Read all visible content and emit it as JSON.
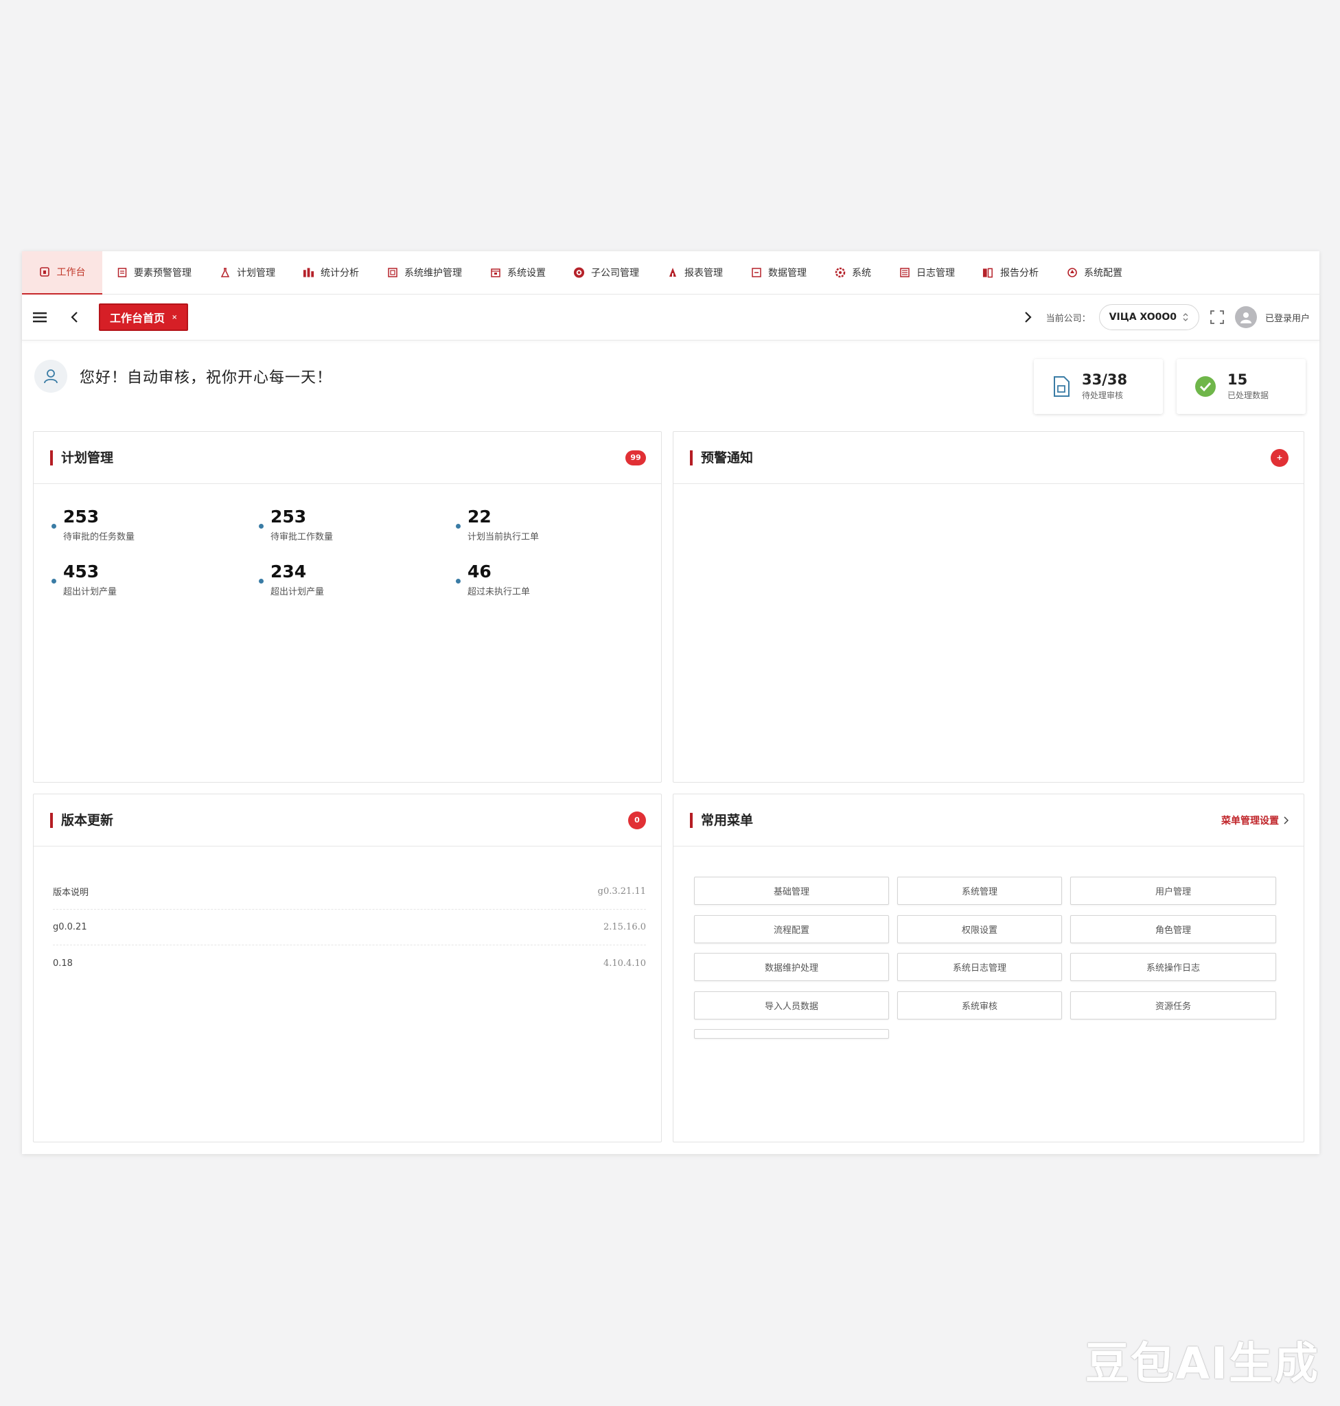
{
  "module_tabs": [
    {
      "label": "工作台",
      "icon": "home-icon"
    },
    {
      "label": "要素预警管理",
      "icon": "document-icon"
    },
    {
      "label": "计划管理",
      "icon": "flask-icon"
    },
    {
      "label": "统计分析",
      "icon": "chart-icon"
    },
    {
      "label": "系统维护管理",
      "icon": "form-icon"
    },
    {
      "label": "系统设置",
      "icon": "calendar-icon"
    },
    {
      "label": "子公司管理",
      "icon": "target-icon"
    },
    {
      "label": "报表管理",
      "icon": "tree-icon"
    },
    {
      "label": "数据管理",
      "icon": "folder-icon"
    },
    {
      "label": "系统",
      "icon": "gear-icon"
    },
    {
      "label": "日志管理",
      "icon": "list-icon"
    },
    {
      "label": "报告分析",
      "icon": "report-icon"
    },
    {
      "label": "系统配置",
      "icon": "settings-icon"
    }
  ],
  "toolbar": {
    "page_tag": "工作台首页",
    "company_label": "当前公司：",
    "company_value": "VIЦA XO0O0",
    "username": "已登录用户"
  },
  "greeting": {
    "text": "您好！自动审核，祝你开心每一天！"
  },
  "stats": [
    {
      "value": "33/38",
      "label": "待处理审核",
      "icon": "document-icon"
    },
    {
      "value": "15",
      "label": "已处理数据",
      "icon": "check-circle-icon"
    }
  ],
  "plan_panel": {
    "title": "计划管理",
    "badge": "99",
    "items": [
      {
        "value": "253",
        "label": "待审批的任务数量"
      },
      {
        "value": "253",
        "label": "待审批工作数量"
      },
      {
        "value": "22",
        "label": "计划当前执行工单"
      },
      {
        "value": "453",
        "label": "超出计划产量"
      },
      {
        "value": "234",
        "label": "超出计划产量"
      },
      {
        "value": "46",
        "label": "超过未执行工单"
      }
    ]
  },
  "alert_panel": {
    "title": "预警通知",
    "badge": "+"
  },
  "version_panel": {
    "title": "版本更新",
    "badge": "0",
    "rows": [
      {
        "name": "版本说明",
        "date": "g0.3.21.11"
      },
      {
        "name": "g0.0.21",
        "date": "2.15.16.0"
      },
      {
        "name": "0.18",
        "date": "4.10.4.10"
      }
    ]
  },
  "menu_panel": {
    "title": "常用菜单",
    "link": "菜单管理设置",
    "items": [
      "基础管理",
      "系统管理",
      "用户管理",
      "流程配置",
      "权限设置",
      "角色管理",
      "数据维护处理",
      "系统日志管理",
      "系统操作日志",
      "导入人员数据",
      "系统审核",
      "资源任务",
      ""
    ]
  },
  "watermark": "豆包AI生成"
}
